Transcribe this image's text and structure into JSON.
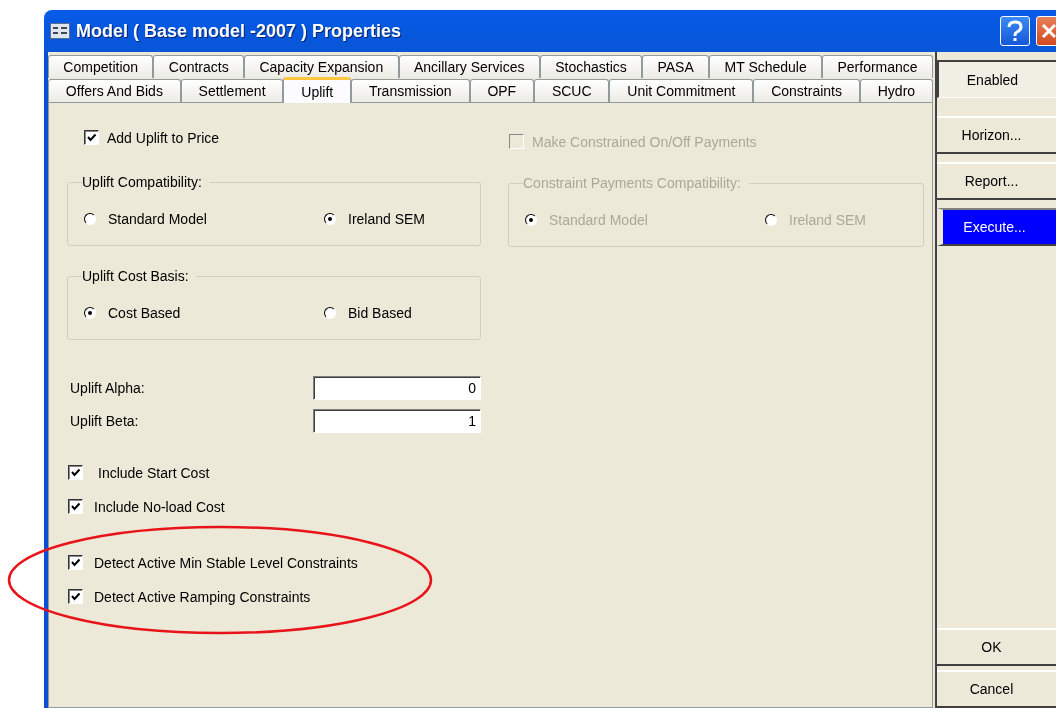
{
  "window": {
    "title": "Model ( Base model -2007 ) Properties"
  },
  "tab_rows": [
    [
      {
        "label": "Competition",
        "selected": false
      },
      {
        "label": "Contracts",
        "selected": false
      },
      {
        "label": "Capacity Expansion",
        "selected": false
      },
      {
        "label": "Ancillary Services",
        "selected": false
      },
      {
        "label": "Stochastics",
        "selected": false
      },
      {
        "label": "PASA",
        "selected": false
      },
      {
        "label": "MT Schedule",
        "selected": false
      },
      {
        "label": "Performance",
        "selected": false
      }
    ],
    [
      {
        "label": "Offers And Bids",
        "selected": false
      },
      {
        "label": "Settlement",
        "selected": false
      },
      {
        "label": "Uplift",
        "selected": true
      },
      {
        "label": "Transmission",
        "selected": false
      },
      {
        "label": "OPF",
        "selected": false
      },
      {
        "label": "SCUC",
        "selected": false
      },
      {
        "label": "Unit Commitment",
        "selected": false
      },
      {
        "label": "Constraints",
        "selected": false
      },
      {
        "label": "Hydro",
        "selected": false
      }
    ]
  ],
  "uplift": {
    "add_uplift": {
      "label": "Add Uplift to Price",
      "checked": true,
      "disabled": false
    },
    "groups": [
      {
        "title": "Uplift Compatibility:",
        "disabled": false,
        "options": [
          {
            "label": "Standard Model",
            "selected": false
          },
          {
            "label": "Ireland SEM",
            "selected": true
          }
        ]
      },
      {
        "title": "Uplift Cost Basis:",
        "disabled": false,
        "options": [
          {
            "label": "Cost Based",
            "selected": true
          },
          {
            "label": "Bid Based",
            "selected": false
          }
        ]
      }
    ],
    "fields": [
      {
        "label": "Uplift Alpha:",
        "value": "0"
      },
      {
        "label": "Uplift Beta:",
        "value": "1"
      }
    ],
    "checks": [
      {
        "label": "Include Start Cost",
        "checked": true,
        "disabled": false
      },
      {
        "label": "Include No-load Cost",
        "checked": true,
        "disabled": false
      },
      {
        "label": "Detect Active Min Stable Level Constraints",
        "checked": true,
        "disabled": false
      },
      {
        "label": "Detect Active Ramping Constraints",
        "checked": true,
        "disabled": false
      }
    ]
  },
  "constraint_payments": {
    "check": {
      "label": "Make Constrained On/Off Payments",
      "checked": false,
      "disabled": true
    },
    "group": {
      "title": "Constraint Payments Compatibility:",
      "disabled": true,
      "options": [
        {
          "label": "Standard Model",
          "selected": true
        },
        {
          "label": "Ireland SEM",
          "selected": false
        }
      ]
    }
  },
  "side_buttons": [
    {
      "label": "Enabled",
      "pressed": true,
      "highlighted": false
    },
    {
      "label": "Horizon...",
      "pressed": false,
      "highlighted": false
    },
    {
      "label": "Report...",
      "pressed": false,
      "highlighted": false
    },
    {
      "label": "Execute...",
      "pressed": false,
      "highlighted": true
    }
  ],
  "bottom_buttons": [
    "OK",
    "Cancel"
  ]
}
